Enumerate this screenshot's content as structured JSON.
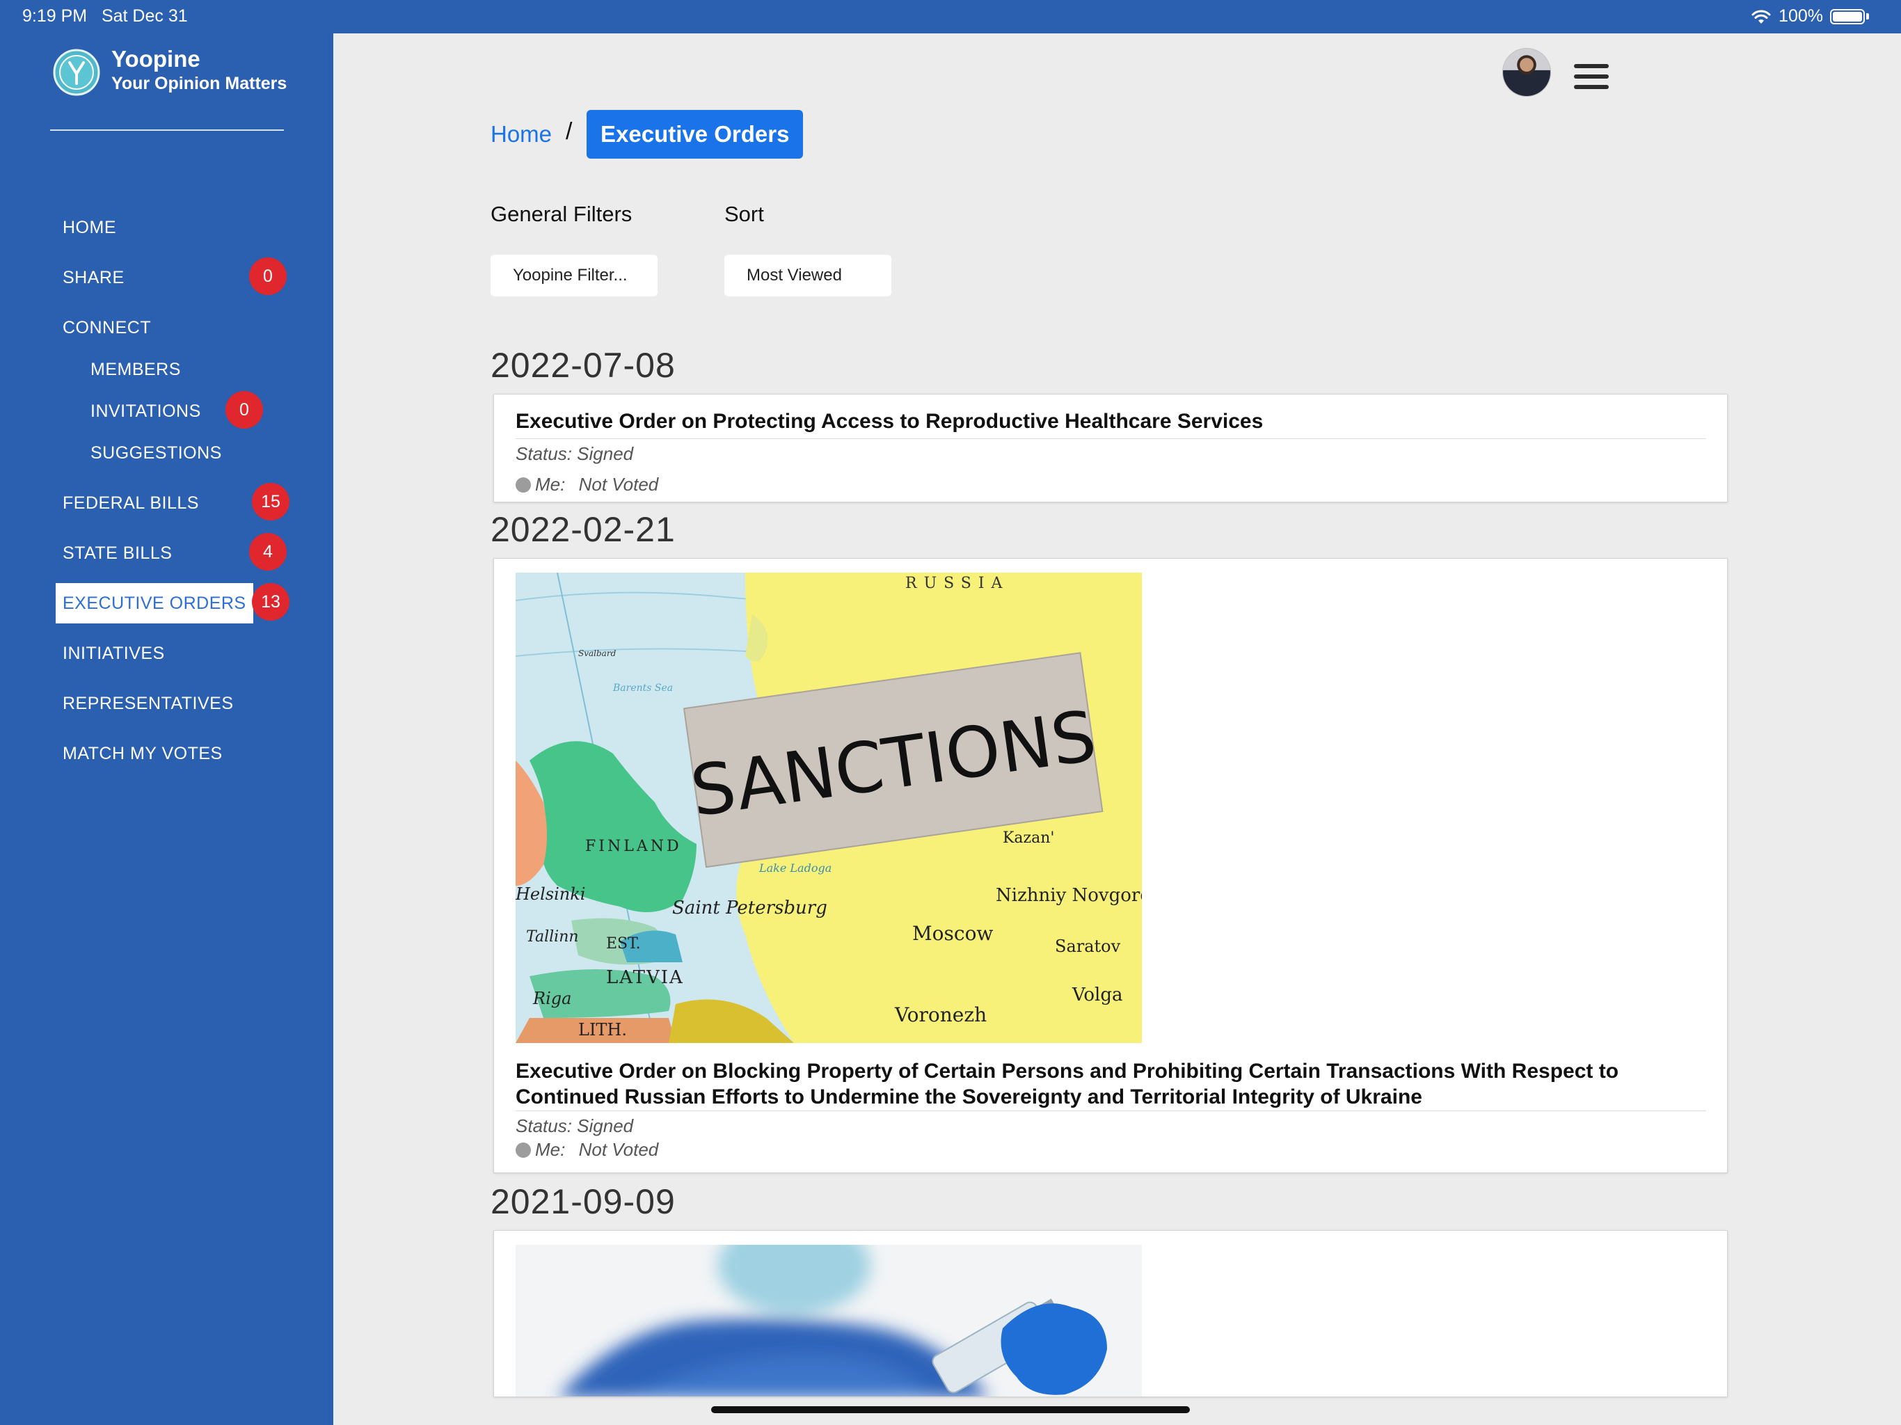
{
  "status_bar": {
    "time": "9:19 PM",
    "date": "Sat Dec 31",
    "battery": "100%"
  },
  "brand": {
    "name": "Yoopine",
    "tagline": "Your Opinion Matters"
  },
  "sidebar": {
    "items": [
      {
        "label": "HOME"
      },
      {
        "label": "SHARE",
        "badge": "0"
      },
      {
        "label": "CONNECT"
      },
      {
        "label": "MEMBERS"
      },
      {
        "label": "INVITATIONS",
        "badge": "0"
      },
      {
        "label": "SUGGESTIONS"
      },
      {
        "label": "FEDERAL BILLS",
        "badge": "15"
      },
      {
        "label": "STATE BILLS",
        "badge": "4"
      },
      {
        "label": "EXECUTIVE ORDERS",
        "badge": "13",
        "active": true
      },
      {
        "label": "INITIATIVES"
      },
      {
        "label": "REPRESENTATIVES"
      },
      {
        "label": "MATCH MY VOTES"
      }
    ]
  },
  "breadcrumb": {
    "home": "Home",
    "separator": "/",
    "current": "Executive Orders"
  },
  "filters": {
    "general_label": "General Filters",
    "general_value": "Yoopine Filter...",
    "sort_label": "Sort",
    "sort_value": "Most Viewed"
  },
  "orders": [
    {
      "date": "2022-07-08",
      "title": "Executive Order on Protecting Access to Reproductive Healthcare Services",
      "status": "Status: Signed",
      "me_label": "Me:",
      "me_value": "Not Voted"
    },
    {
      "date": "2022-02-21",
      "image": "sanctions-map-image",
      "image_text": "SANCTIONS",
      "map_labels": [
        "RUSSIA",
        "FINLAND",
        "Helsinki",
        "Tallinn",
        "EST.",
        "LATVIA",
        "Riga",
        "LITH.",
        "Saint Petersburg",
        "Moscow",
        "Nizhniy Novgorod",
        "Kazan'",
        "Voronezh",
        "Saratov",
        "Volga",
        "Barents Sea",
        "Svalbard",
        "Lake Ladoga"
      ],
      "title": "Executive Order on Blocking Property of Certain Persons and Prohibiting Certain Transactions With Respect to Continued Russian Efforts to Undermine the Sovereignty and Territorial Integrity of Ukraine",
      "status": "Status: Signed",
      "me_label": "Me:",
      "me_value": "Not Voted"
    },
    {
      "date": "2021-09-09",
      "image": "vaccine-image"
    }
  ],
  "colors": {
    "sidebar": "#2b5faf",
    "accent": "#1a73e8",
    "badge": "#e0272e",
    "background": "#ececec"
  }
}
